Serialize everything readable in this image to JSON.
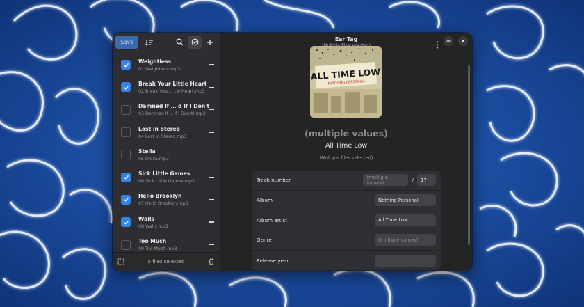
{
  "window": {
    "title": "Ear Tag",
    "subtitle": "(Multiple files selected)"
  },
  "sidebar": {
    "save_label": "Save",
    "files": [
      {
        "title": "Weightless",
        "file": "01 Weightless.mp3",
        "checked": true
      },
      {
        "title": "Break Your Little Heart",
        "file": "02 Break Your… tle Heart.mp3",
        "checked": true
      },
      {
        "title": "Damned If … d If I Don't)",
        "file": "03 Damned If … f I Don't).mp3",
        "checked": false
      },
      {
        "title": "Lost in Stereo",
        "file": "04 Lost in Stereo.mp3",
        "checked": false
      },
      {
        "title": "Stella",
        "file": "05 Stella.mp3",
        "checked": false
      },
      {
        "title": "Sick Little Games",
        "file": "06 Sick Little Games.mp3",
        "checked": true
      },
      {
        "title": "Hello Brooklyn",
        "file": "07 Hello Brooklyn.mp3",
        "checked": true
      },
      {
        "title": "Walls",
        "file": "08 Walls.mp3",
        "checked": true
      },
      {
        "title": "Too Much",
        "file": "09 Too Much.mp3",
        "checked": false
      }
    ],
    "footer_count": "5 files selected"
  },
  "main": {
    "cover": {
      "band": "ALL TIME LOW",
      "album_text": "NOTHING PERSONAL"
    },
    "title": "(multiple values)",
    "artist": "All Time Low",
    "files_selected": "(Multiple files selected)",
    "props": {
      "track_number_label": "Track number",
      "track_number_value": "(multiple values)",
      "track_total": "17",
      "album_label": "Album",
      "album_value": "Nothing Personal",
      "album_artist_label": "Album artist",
      "album_artist_value": "All Time Low",
      "genre_label": "Genre",
      "genre_value": "(multiple values)",
      "release_year_label": "Release year",
      "release_year_value": ""
    }
  },
  "colors": {
    "accent": "#3584e4",
    "save_bg": "#3a6bb0",
    "window_bg": "#242424",
    "sidebar_bg": "#2e2e32"
  }
}
